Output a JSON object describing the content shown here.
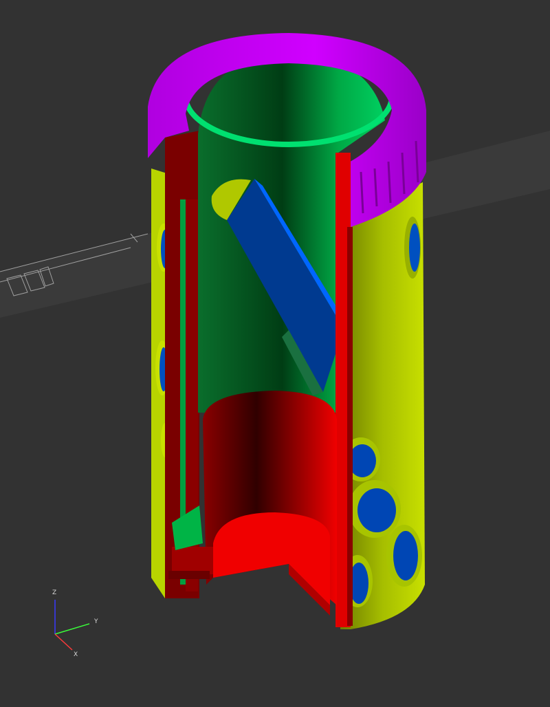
{
  "viewport": {
    "background": "#323232",
    "colors": {
      "collar": "#c000f0",
      "sleeve": "#b4d200",
      "inner_tube": "#00b446",
      "red_part": "#e60000",
      "dark_red": "#780000",
      "blue_faces": "#0046b4"
    }
  },
  "axes": {
    "z_label": "Z",
    "y_label": "Y",
    "x_label": "X",
    "z_color": "#3a3aff",
    "y_color": "#3aff3a",
    "x_color": "#ff3a3a"
  }
}
